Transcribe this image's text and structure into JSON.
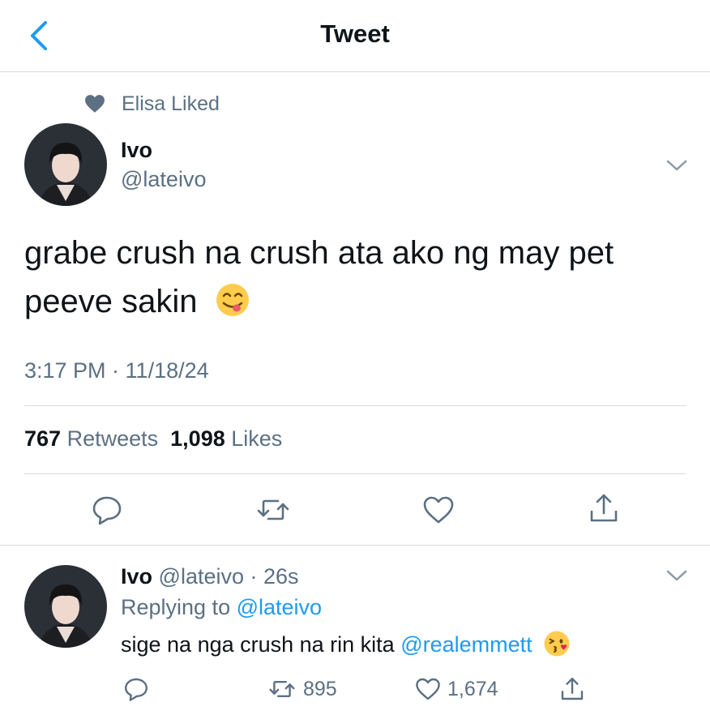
{
  "header": {
    "title": "Tweet"
  },
  "social_context": {
    "text": "Elisa Liked"
  },
  "tweet": {
    "name": "Ivo",
    "handle": "@lateivo",
    "text": "grabe crush na crush ata ako ng may pet peeve sakin",
    "timestamp": "3:17 PM · 11/18/24",
    "retweets": "767",
    "retweets_label": "Retweets",
    "likes": "1,098",
    "likes_label": "Likes"
  },
  "reply": {
    "name": "Ivo",
    "handle": "@lateivo",
    "age": "· 26s",
    "replying_prefix": "Replying to",
    "replying_to": "@lateivo",
    "text": "sige na nga crush na rin kita",
    "mention": "@realemmett",
    "retweets": "895",
    "likes": "1,674"
  },
  "colors": {
    "accent": "#1d9bf0",
    "secondary_text": "#5b7083",
    "divider": "#d6d9dc"
  },
  "icons": [
    "back-chevron-icon",
    "heart-filled-icon",
    "chevron-down-icon",
    "reply-icon",
    "retweet-icon",
    "like-icon",
    "share-icon",
    "yum-emoji-icon",
    "kiss-emoji-icon"
  ]
}
